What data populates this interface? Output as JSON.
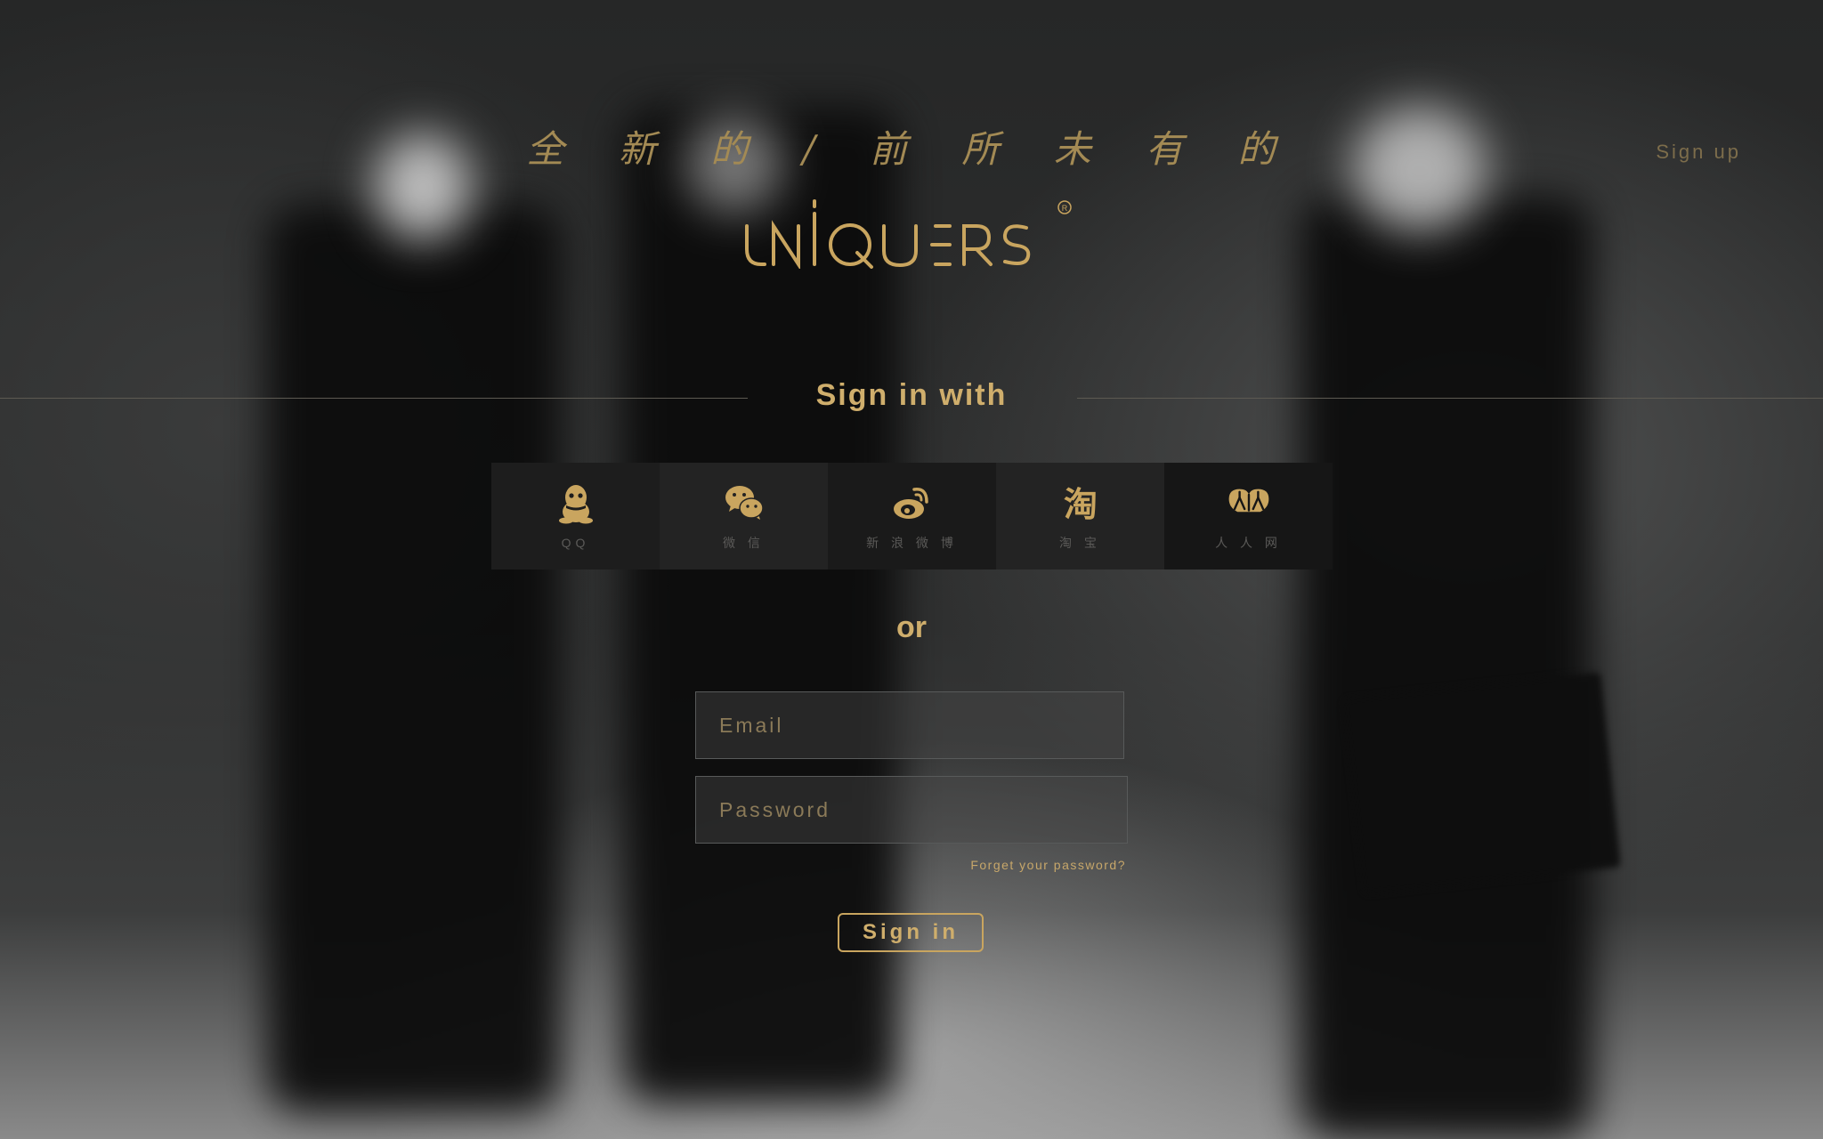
{
  "header": {
    "tagline": "全 新 的 / 前 所 未 有 的",
    "logo_text": "UNIQUERS",
    "signup_label": "Sign up"
  },
  "social": {
    "heading": "Sign in  with",
    "buttons": [
      {
        "label": "QQ",
        "icon": "qq-penguin-icon"
      },
      {
        "label": "微 信",
        "icon": "wechat-icon"
      },
      {
        "label": "新 浪 微 博",
        "icon": "weibo-icon"
      },
      {
        "label": "淘 宝",
        "icon": "taobao-icon"
      },
      {
        "label": "人 人 网",
        "icon": "renren-icon"
      }
    ]
  },
  "separator_text": "or",
  "form": {
    "email_placeholder": "Email",
    "password_placeholder": "Password",
    "forgot_label": "Forget your password?",
    "submit_label": "Sign  in"
  },
  "colors": {
    "accent": "#cfae6c",
    "background": "#2b2c2c"
  }
}
